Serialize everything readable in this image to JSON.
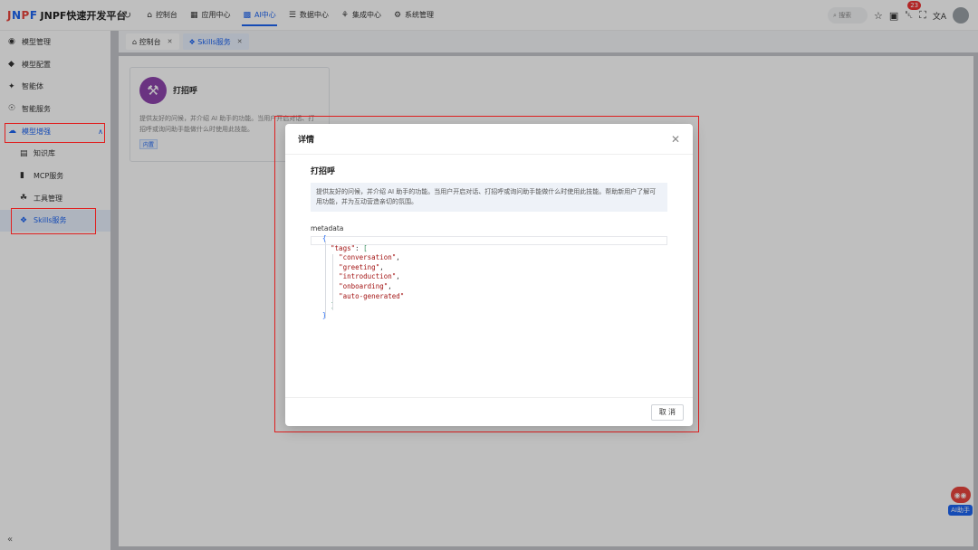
{
  "app": {
    "logo_mark": "JNPF",
    "logo_text": "JNPF快速开发平台"
  },
  "topnav": [
    {
      "label": "控制台",
      "icon": "home-icon"
    },
    {
      "label": "应用中心",
      "icon": "app-icon"
    },
    {
      "label": "AI中心",
      "icon": "grid-icon",
      "active": true
    },
    {
      "label": "数据中心",
      "icon": "database-icon"
    },
    {
      "label": "集成中心",
      "icon": "integration-icon"
    },
    {
      "label": "系统管理",
      "icon": "gear-icon"
    }
  ],
  "topright": {
    "search_placeholder": "搜索",
    "notification_count": "23"
  },
  "sidebar": [
    {
      "label": "模型管理"
    },
    {
      "label": "模型配置"
    },
    {
      "label": "智能体"
    },
    {
      "label": "智能服务"
    },
    {
      "label": "模型增强"
    },
    {
      "label": "知识库"
    },
    {
      "label": "MCP服务"
    },
    {
      "label": "工具管理"
    },
    {
      "label": "Skills服务"
    }
  ],
  "tabs": [
    {
      "label": "控制台"
    },
    {
      "label": "Skills服务"
    }
  ],
  "card": {
    "title": "打招呼",
    "desc": "提供友好的问候，并介绍 AI 助手的功能。当用户开启对话、打招呼或询问助手能做什么时使用此技能。",
    "tag": "内置"
  },
  "modal": {
    "title": "详情",
    "skill_name": "打招呼",
    "skill_desc": "提供友好的问候，并介绍 AI 助手的功能。当用户开启对话、打招呼或询问助手能做什么时使用此技能。帮助新用户了解可用功能，并为互动营造亲切的氛围。",
    "meta_label": "metadata",
    "metadata": {
      "tags_key": "\"tags\"",
      "tags": [
        "\"conversation\"",
        "\"greeting\"",
        "\"introduction\"",
        "\"onboarding\"",
        "\"auto-generated\""
      ]
    },
    "cancel_label": "取 消"
  },
  "ai_helper": {
    "label": "AI助手"
  },
  "colors": {
    "accent": "#1c64f2",
    "annotation": "#e02020",
    "brand_red": "#e8453c"
  }
}
